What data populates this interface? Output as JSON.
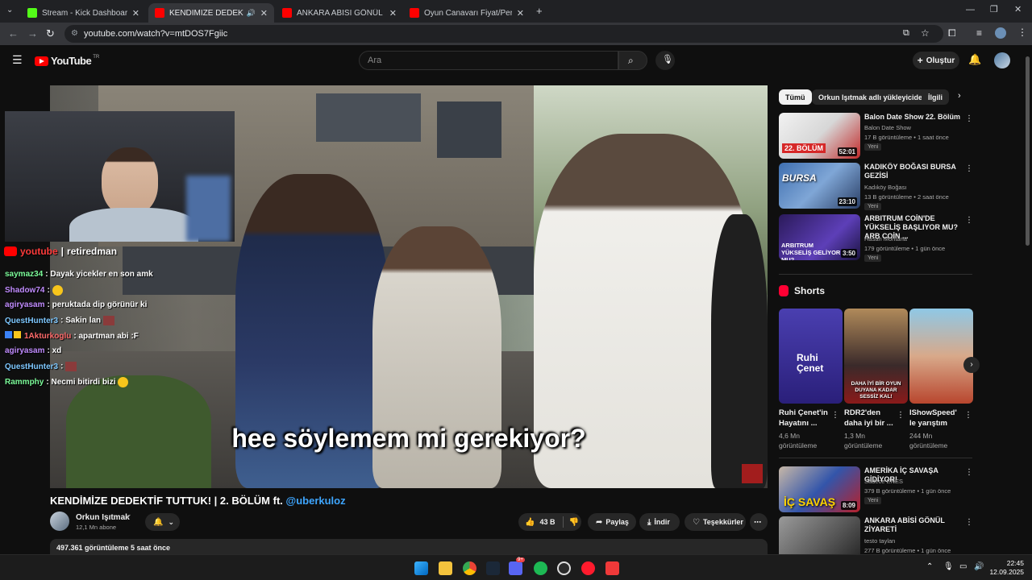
{
  "browser": {
    "tabs": [
      {
        "label": "Stream - Kick Dashboard",
        "favicon_color": "#53fc18",
        "active": false
      },
      {
        "label": "KENDİMİZE DEDEKTİF TUTT",
        "favicon_color": "#ff0000",
        "active": true
      },
      {
        "label": "ANKARA ABİSİ GÖNÜL ZİYARET",
        "favicon_color": "#ff0000",
        "active": false
      },
      {
        "label": "Oyun Canavarı Fiyat/Performan",
        "favicon_color": "#ff0000",
        "active": false
      }
    ],
    "url": "youtube.com/watch?v=mtDOS7Fgiic"
  },
  "youtube_header": {
    "logo_text": "YouTube",
    "region": "TR",
    "search_placeholder": "Ara",
    "create_label": "Oluştur"
  },
  "video": {
    "subtitle": "hee söylemem mi gerekiyor?",
    "title_main": "KENDİMİZE DEDEKTİF TUTTUK! | 2. BÖLÜM ft.",
    "title_link": "@uberkuloz",
    "channel": "Orkun Işıtmak",
    "subscribers": "12,1 Mn abone",
    "likes": "43 B",
    "share_label": "Paylaş",
    "download_label": "İndir",
    "thanks_label": "Teşekkürler",
    "views_line": "497.361 görüntüleme  5 saat önce"
  },
  "overlay": {
    "stream_brand": "youtube",
    "stream_user": "retiredman",
    "chat": [
      {
        "user": "saymaz34",
        "user_color": "#7cfc9a",
        "text": ": Dayak yicekler en son amk"
      },
      {
        "user": "Shadow74",
        "user_color": "#c18cff",
        "text": ":"
      },
      {
        "user": "agiryasam",
        "user_color": "#c18cff",
        "text": ": peruktada dip görünür ki"
      },
      {
        "user": "QuestHunter3",
        "user_color": "#7ec8ff",
        "text": ": Sakin lan"
      },
      {
        "user": "1Akturkoglu",
        "user_color": "#ff6b6b",
        "text": ": apartman abi :F"
      },
      {
        "user": "agiryasam",
        "user_color": "#c18cff",
        "text": ": xd"
      },
      {
        "user": "QuestHunter3",
        "user_color": "#7ec8ff",
        "text": ":"
      },
      {
        "user": "Rammphy",
        "user_color": "#7cfc9a",
        "text": ": Necmi bitirdi bizi"
      }
    ]
  },
  "sidebar": {
    "chips": [
      "Tümü",
      "Orkun Işıtmak adlı yükleyiciden",
      "İlgili"
    ],
    "recommendations": [
      {
        "title": "Balon Date Show 22. Bölüm",
        "channel": "Balon Date Show",
        "meta": "17 B görüntüleme • 1 saat önce",
        "badge": "Yeni",
        "duration": "52:01",
        "thumb_text": "22. BÖLÜM"
      },
      {
        "title": "KADIKÖY BOĞASI BURSA GEZİSİ",
        "channel": "Kadıköy Boğası",
        "meta": "13 B görüntüleme • 2 saat önce",
        "badge": "Yeni",
        "duration": "23:10",
        "thumb_text": "BURSA"
      },
      {
        "title": "ARBITRUM COİN'DE YÜKSELİŞ BAŞLIYOR MU? ARB COİN ...",
        "channel": "Hasan Montana",
        "meta": "179 görüntüleme • 1 gün önce",
        "badge": "Yeni",
        "duration": "3:50",
        "thumb_text": "ARBITRUM YÜKSELİŞ GELİYOR MU?"
      }
    ],
    "shorts_label": "Shorts",
    "shorts": [
      {
        "title": "Ruhi Çenet'in Hayatını ...",
        "views": "4,6 Mn görüntüleme",
        "thumb_text": "Ruhi Çenet"
      },
      {
        "title": "RDR2'den daha iyi bir ...",
        "views": "1,3 Mn görüntüleme",
        "thumb_text": "DAHA İYİ BİR OYUN DUYANA KADAR SESSİZ KAL!"
      },
      {
        "title": "IShowSpeed' le yarıştım",
        "views": "244 Mn görüntüleme",
        "thumb_text": ""
      }
    ],
    "more_recommendations": [
      {
        "title": "AMERİKA İÇ SAVAŞA GİDİYOR!",
        "channel": "Sadece ENES",
        "meta": "379 B görüntüleme • 1 gün önce",
        "badge": "Yeni",
        "duration": "8:09",
        "thumb_text": "İÇ SAVAŞ"
      },
      {
        "title": "ANKARA ABİSİ GÖNÜL ZİYARETİ",
        "channel": "testo taylan",
        "meta": "277 B görüntüleme • 1 gün önce",
        "badge": "",
        "duration": "",
        "thumb_text": ""
      }
    ]
  },
  "taskbar": {
    "time": "22:45",
    "date": "12.09.2025",
    "discord_badge": "9+"
  },
  "colors": {
    "youtube_red": "#ff0000",
    "link_blue": "#3ea6ff",
    "bg": "#0f0f0f"
  }
}
